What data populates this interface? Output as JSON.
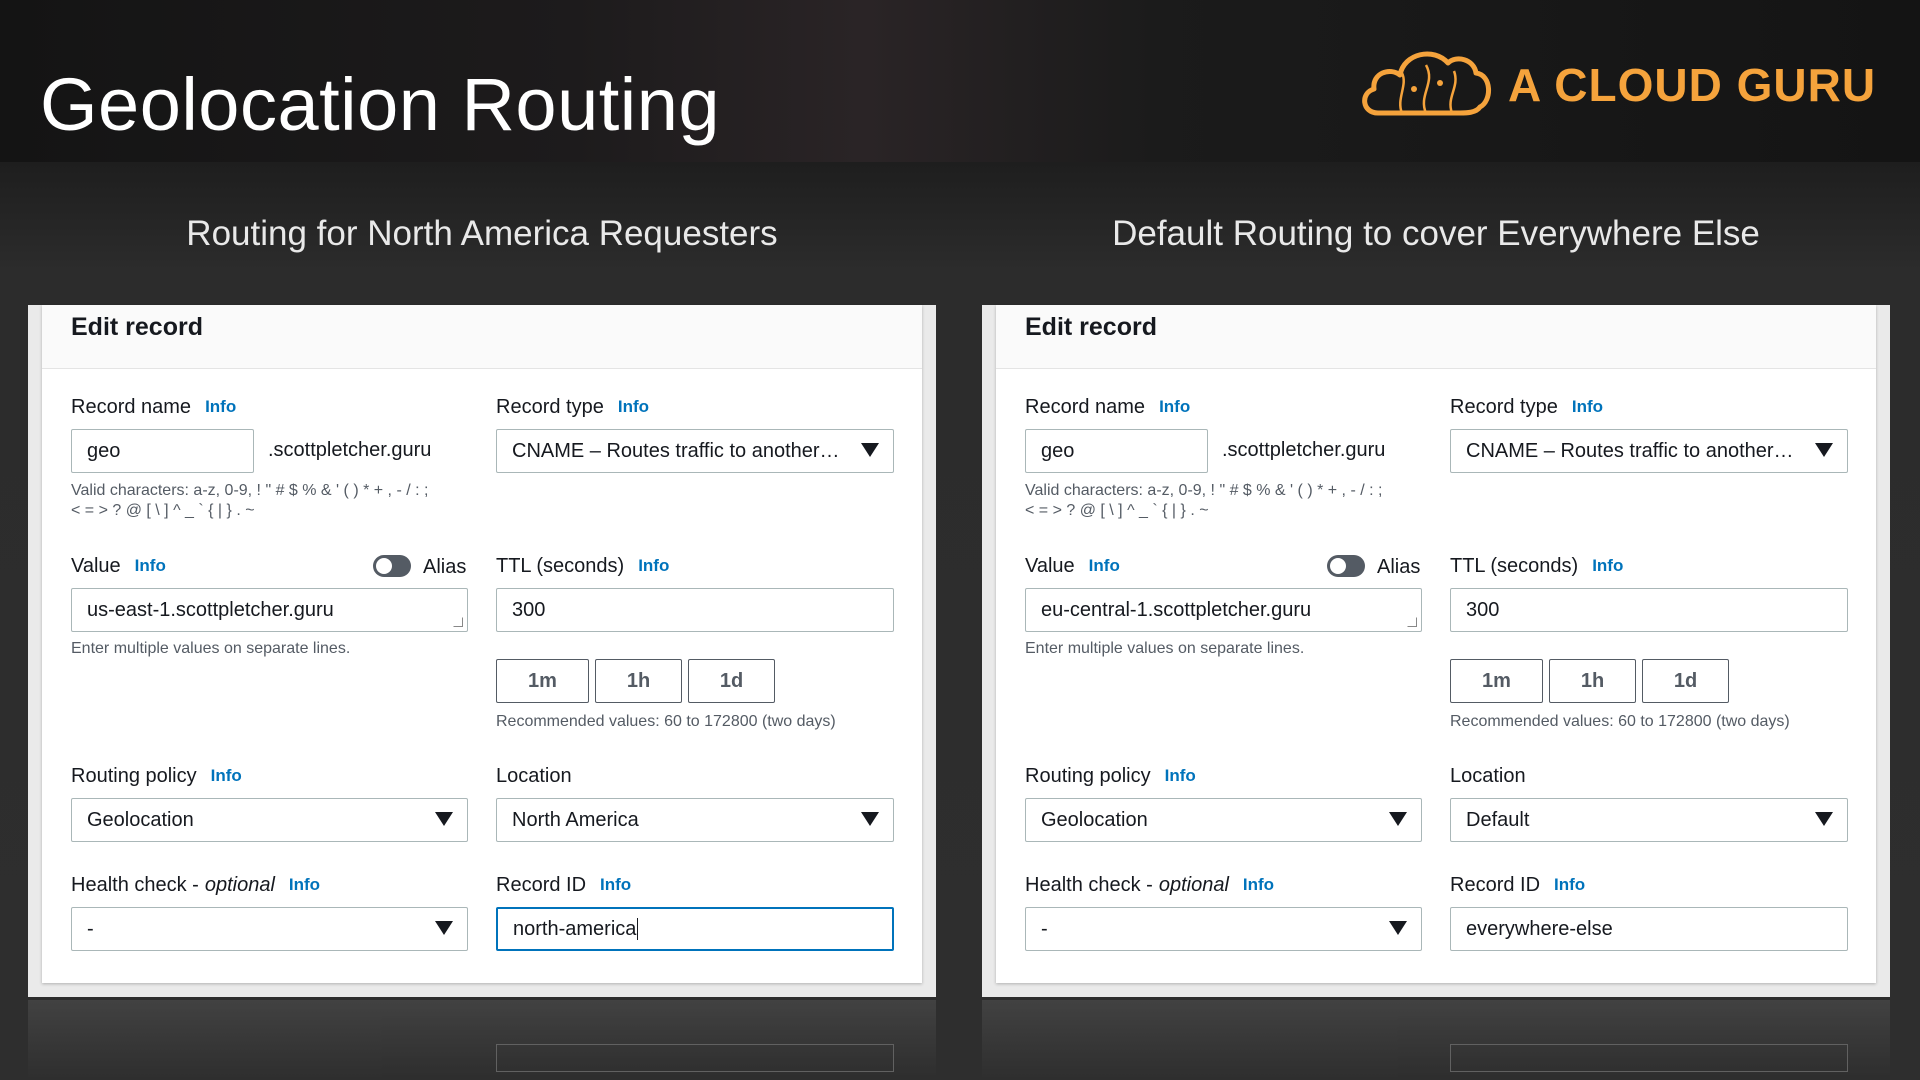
{
  "slide": {
    "title": "Geolocation Routing",
    "brand": "A CLOUD GURU",
    "brand_color": "#f5a33c"
  },
  "columns": [
    {
      "heading": "Routing for North America Requesters",
      "panel_title": "Edit record",
      "record_name_label": "Record name",
      "info": "Info",
      "record_name_value": "geo",
      "domain_suffix": ".scottpletcher.guru",
      "valid_chars_line1": "Valid characters: a-z, 0-9, ! \" # $ % & ' ( ) * + , - / : ;",
      "valid_chars_line2": "< = > ? @ [ \\ ] ^ _ ` { | } . ~",
      "record_type_label": "Record type",
      "record_type_value": "CNAME – Routes traffic to another…",
      "value_label": "Value",
      "alias_label": "Alias",
      "value_text": "us-east-1.scottpletcher.guru",
      "value_hint": "Enter multiple values on separate lines.",
      "ttl_label": "TTL (seconds)",
      "ttl_value": "300",
      "ttl_buttons": [
        "1m",
        "1h",
        "1d"
      ],
      "ttl_hint": "Recommended values: 60 to 172800 (two days)",
      "routing_policy_label": "Routing policy",
      "routing_policy_value": "Geolocation",
      "location_label": "Location",
      "location_value": "North America",
      "health_check_label": "Health check -",
      "health_check_optional": "optional",
      "health_check_value": "-",
      "record_id_label": "Record ID",
      "record_id_value": "north-america"
    },
    {
      "heading": "Default Routing to cover Everywhere Else",
      "panel_title": "Edit record",
      "record_name_label": "Record name",
      "info": "Info",
      "record_name_value": "geo",
      "domain_suffix": ".scottpletcher.guru",
      "valid_chars_line1": "Valid characters: a-z, 0-9, ! \" # $ % & ' ( ) * + , - / : ;",
      "valid_chars_line2": "< = > ? @ [ \\ ] ^ _ ` { | } . ~",
      "record_type_label": "Record type",
      "record_type_value": "CNAME – Routes traffic to another…",
      "value_label": "Value",
      "alias_label": "Alias",
      "value_text": "eu-central-1.scottpletcher.guru",
      "value_hint": "Enter multiple values on separate lines.",
      "ttl_label": "TTL (seconds)",
      "ttl_value": "300",
      "ttl_buttons": [
        "1m",
        "1h",
        "1d"
      ],
      "ttl_hint": "Recommended values: 60 to 172800 (two days)",
      "routing_policy_label": "Routing policy",
      "routing_policy_value": "Geolocation",
      "location_label": "Location",
      "location_value": "Default",
      "health_check_label": "Health check -",
      "health_check_optional": "optional",
      "health_check_value": "-",
      "record_id_label": "Record ID",
      "record_id_value": "everywhere-else"
    }
  ],
  "colors": {
    "info_link": "#0073bb",
    "focus_border": "#0073bb",
    "toggle_off": "#545b64"
  }
}
